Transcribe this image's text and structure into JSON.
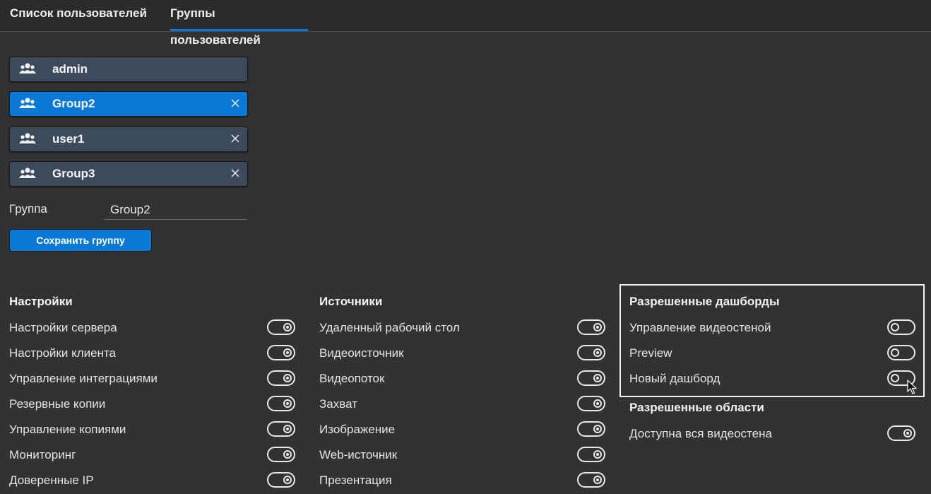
{
  "tabs": [
    {
      "label": "Список пользователей",
      "active": false
    },
    {
      "label": "Группы пользователей",
      "active": true
    }
  ],
  "groups": [
    {
      "name": "admin",
      "removable": false,
      "selected": false,
      "icon": "users-icon"
    },
    {
      "name": "Group2",
      "removable": true,
      "selected": true,
      "icon": "users-icon"
    },
    {
      "name": "user1",
      "removable": true,
      "selected": false,
      "icon": "users-icon"
    },
    {
      "name": "Group3",
      "removable": true,
      "selected": false,
      "icon": "users-icon"
    }
  ],
  "group_form": {
    "label": "Группа",
    "value": "Group2",
    "save_label": "Сохранить группу"
  },
  "settings": {
    "title": "Настройки",
    "items": [
      {
        "label": "Настройки сервера",
        "enabled": true
      },
      {
        "label": "Настройки клиента",
        "enabled": true
      },
      {
        "label": "Управление интеграциями",
        "enabled": true
      },
      {
        "label": "Резервные копии",
        "enabled": true
      },
      {
        "label": "Управление копиями",
        "enabled": true
      },
      {
        "label": "Мониторинг",
        "enabled": true
      },
      {
        "label": "Доверенные IP",
        "enabled": true
      }
    ]
  },
  "sources": {
    "title": "Источники",
    "items": [
      {
        "label": "Удаленный рабочий стол",
        "enabled": true
      },
      {
        "label": "Видеоисточник",
        "enabled": true
      },
      {
        "label": "Видеопоток",
        "enabled": true
      },
      {
        "label": "Захват",
        "enabled": true
      },
      {
        "label": "Изображение",
        "enabled": true
      },
      {
        "label": "Web-источник",
        "enabled": true
      },
      {
        "label": "Презентация",
        "enabled": true
      }
    ]
  },
  "dashboards": {
    "title": "Разрешенные дашборды",
    "items": [
      {
        "label": "Управление видеостеной",
        "enabled": false
      },
      {
        "label": "Preview",
        "enabled": false
      },
      {
        "label": "Новый дашборд",
        "enabled": false
      }
    ]
  },
  "areas": {
    "title": "Разрешенные области",
    "items": [
      {
        "label": "Доступна вся видеостена",
        "enabled": true
      }
    ]
  },
  "colors": {
    "background": "#323232",
    "accent": "#0a78d6",
    "group_item": "#3c4a5c"
  }
}
